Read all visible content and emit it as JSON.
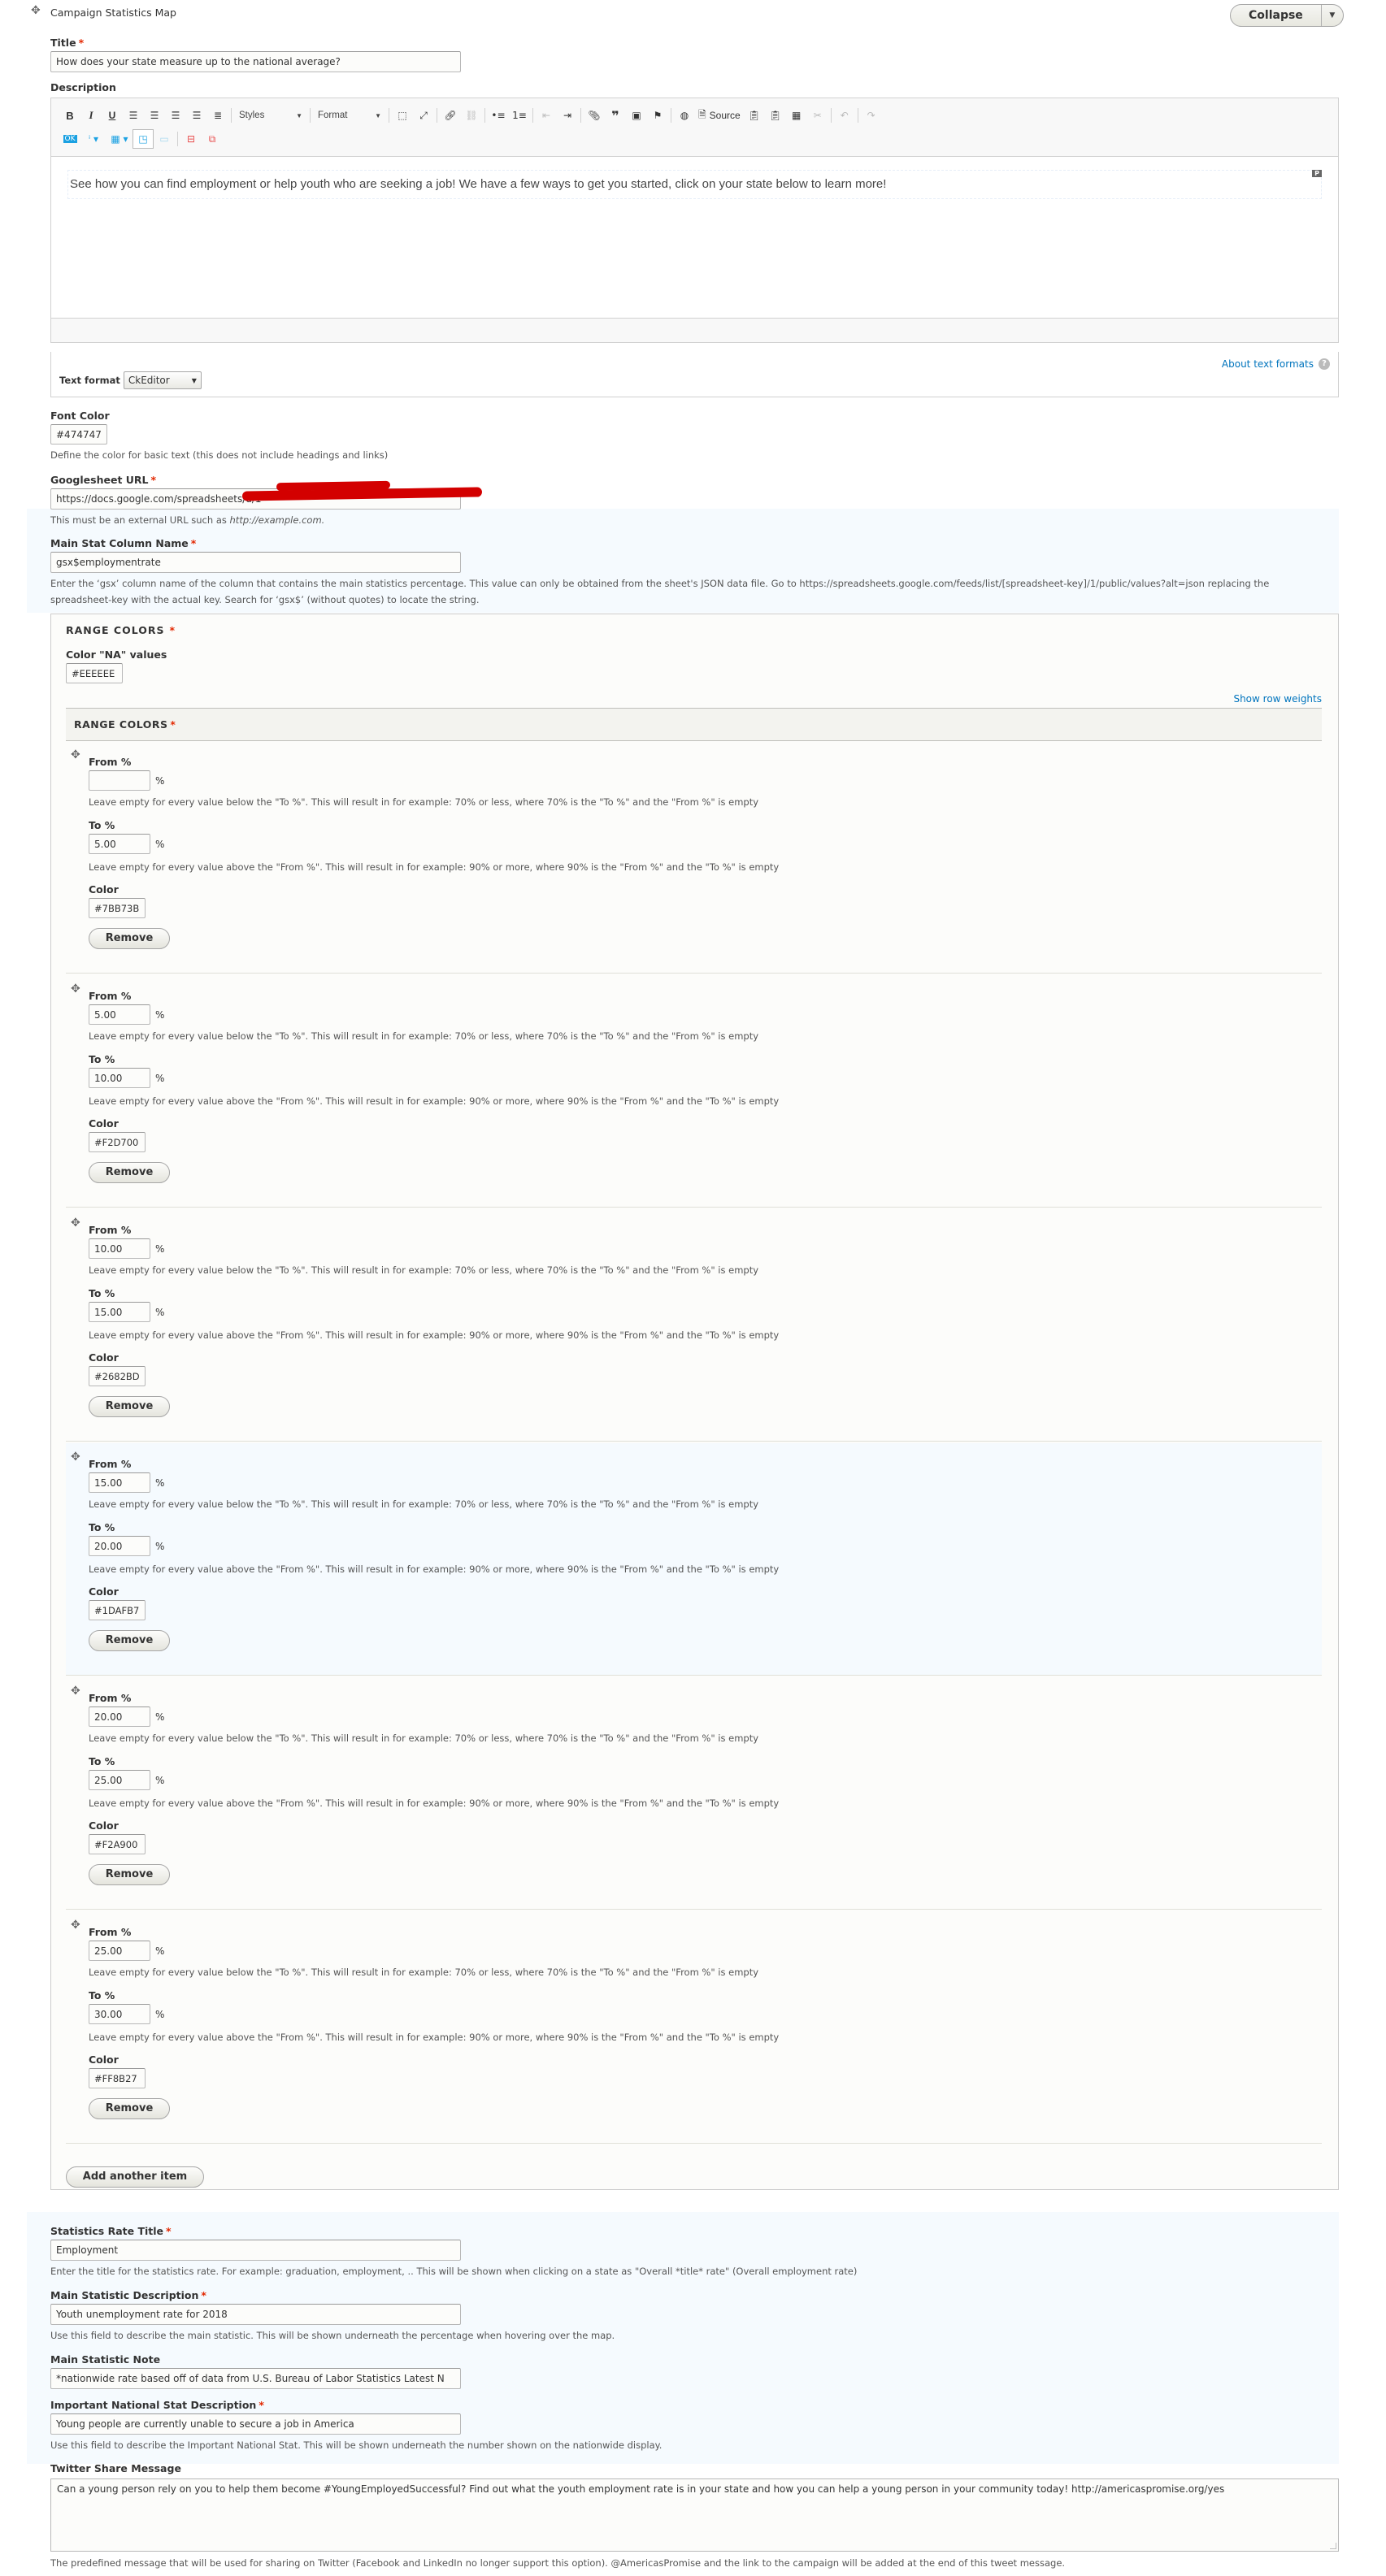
{
  "header": {
    "title": "Campaign Statistics Map",
    "collapse_label": "Collapse"
  },
  "title_field": {
    "label": "Title",
    "value": "How does your state measure up to the national average?"
  },
  "description_field": {
    "label": "Description",
    "toolbar": {
      "styles_label": "Styles",
      "format_label": "Format",
      "source_label": "Source"
    },
    "content": "See how you can find employment or help youth who are seeking a job!  We have a few ways to get you started, click on your state below to learn more!",
    "block_badge": "P",
    "text_format_label": "Text format",
    "text_format_value": "CkEditor",
    "about_formats_link": "About text formats"
  },
  "font_color": {
    "label": "Font Color",
    "value": "#474747",
    "description": "Define the color for basic text (this does not include headings and links)"
  },
  "googlesheet_url": {
    "label": "Googlesheet URL",
    "value": "https://docs.google.com/spreadsheets/d/1",
    "description_prefix": "This must be an external URL such as ",
    "description_example": "http://example.com."
  },
  "main_stat_column": {
    "label": "Main Stat Column Name",
    "value": "gsx$employmentrate",
    "description_line1": "Enter the ‘gsx’ column name of the column that contains the main statistics percentage. This value can only be obtained from the sheet's JSON data file. Go to https://spreadsheets.google.com/feeds/list/[spreadsheet-key]/1/public/values?alt=json replacing the",
    "description_line2": "spreadsheet-key with the actual key. Search for ‘gsx$’ (without quotes) to locate the string."
  },
  "range_colors": {
    "legend": "RANGE COLORS",
    "na_label": "Color \"NA\" values",
    "na_value": "#EEEEEE",
    "show_row_weights": "Show row weights",
    "table_header": "RANGE COLORS",
    "from_label": "From %",
    "to_label": "To %",
    "color_label": "Color",
    "pct_suffix": "%",
    "from_hint": "Leave empty for every value below the \"To %\". This will result in for example: 70% or less, where 70% is the \"To %\" and the \"From %\" is empty",
    "to_hint": "Leave empty for every value above the \"From %\". This will result in for example: 90% or more, where 90% is the \"From %\" and the \"To %\" is empty",
    "remove_label": "Remove",
    "add_label": "Add another item",
    "rows": [
      {
        "from": "",
        "to": "5.00",
        "color": "#7BB73B"
      },
      {
        "from": "5.00",
        "to": "10.00",
        "color": "#F2D700"
      },
      {
        "from": "10.00",
        "to": "15.00",
        "color": "#2682BD"
      },
      {
        "from": "15.00",
        "to": "20.00",
        "color": "#1DAFB7"
      },
      {
        "from": "20.00",
        "to": "25.00",
        "color": "#F2A900"
      },
      {
        "from": "25.00",
        "to": "30.00",
        "color": "#FF8B27"
      }
    ]
  },
  "stat_rate_title": {
    "label": "Statistics Rate Title",
    "value": "Employment",
    "description": "Enter the title for the statistics rate. For example: graduation, employment, .. This will be shown when clicking on a state as \"Overall *title* rate\" (Overall employment rate)"
  },
  "main_stat_description": {
    "label": "Main Statistic Description",
    "value": "Youth  unemployment rate for 2018",
    "description": "Use this field to describe the main statistic. This will be shown underneath the percentage when hovering over the map."
  },
  "main_stat_note": {
    "label": "Main Statistic Note",
    "value": "*nationwide rate based off of data from U.S. Bureau of Labor Statistics Latest N"
  },
  "national_stat_description": {
    "label": "Important National Stat Description",
    "value": "Young people are currently unable to secure a job in America",
    "description": "Use this field to describe the Important National Stat. This will be shown underneath the number shown on the nationwide display."
  },
  "twitter_share": {
    "label": "Twitter Share Message",
    "value": "Can a young person rely on you to help them become #YoungEmployedSuccessful? Find out what the youth employment rate is in your state and how you can help a young person in your community today! http://americaspromise.org/yes",
    "description": "The predefined message that will be used for sharing on Twitter (Facebook and LinkedIn no longer support this option).  @AmericasPromise and the link to the campaign will be added at the end of this tweet message."
  }
}
